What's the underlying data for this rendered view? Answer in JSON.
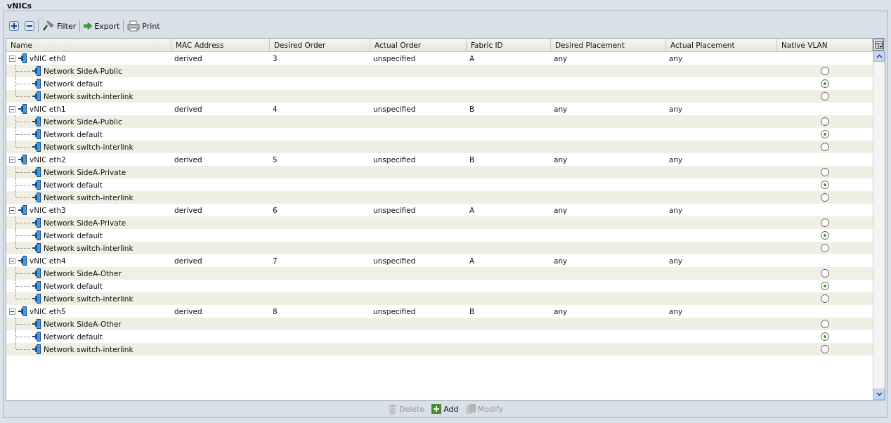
{
  "panel": {
    "title": "vNICs"
  },
  "toolbar": [
    {
      "kind": "expand"
    },
    {
      "kind": "collapse"
    },
    {
      "kind": "filter",
      "label": "Filter"
    },
    {
      "kind": "export",
      "label": "Export"
    },
    {
      "kind": "print",
      "label": "Print"
    }
  ],
  "table": {
    "columns": [
      "Name",
      "MAC Address",
      "Desired Order",
      "Actual Order",
      "Fabric ID",
      "Desired Placement",
      "Actual Placement",
      "Native VLAN"
    ],
    "rows": [
      {
        "name": "vNIC eth0",
        "mac": "derived",
        "desired_order": "3",
        "actual_order": "unspecified",
        "fabric_id": "A",
        "desired_placement": "any",
        "actual_placement": "any",
        "expanded": true,
        "children": [
          {
            "name": "Network SideA-Public",
            "selected": false
          },
          {
            "name": "Network default",
            "selected": true
          },
          {
            "name": "Network switch-interlink",
            "selected": false
          }
        ]
      },
      {
        "name": "vNIC eth1",
        "mac": "derived",
        "desired_order": "4",
        "actual_order": "unspecified",
        "fabric_id": "B",
        "desired_placement": "any",
        "actual_placement": "any",
        "expanded": true,
        "children": [
          {
            "name": "Network SideA-Public",
            "selected": false
          },
          {
            "name": "Network default",
            "selected": true
          },
          {
            "name": "Network switch-interlink",
            "selected": false
          }
        ]
      },
      {
        "name": "vNIC eth2",
        "mac": "derived",
        "desired_order": "5",
        "actual_order": "unspecified",
        "fabric_id": "B",
        "desired_placement": "any",
        "actual_placement": "any",
        "expanded": true,
        "children": [
          {
            "name": "Network SideA-Private",
            "selected": false
          },
          {
            "name": "Network default",
            "selected": true
          },
          {
            "name": "Network switch-interlink",
            "selected": false
          }
        ]
      },
      {
        "name": "vNIC eth3",
        "mac": "derived",
        "desired_order": "6",
        "actual_order": "unspecified",
        "fabric_id": "A",
        "desired_placement": "any",
        "actual_placement": "any",
        "expanded": true,
        "children": [
          {
            "name": "Network SideA-Private",
            "selected": false
          },
          {
            "name": "Network default",
            "selected": true
          },
          {
            "name": "Network switch-interlink",
            "selected": false
          }
        ]
      },
      {
        "name": "vNIC eth4",
        "mac": "derived",
        "desired_order": "7",
        "actual_order": "unspecified",
        "fabric_id": "A",
        "desired_placement": "any",
        "actual_placement": "any",
        "expanded": true,
        "children": [
          {
            "name": "Network SideA-Other",
            "selected": false
          },
          {
            "name": "Network default",
            "selected": true
          },
          {
            "name": "Network switch-interlink",
            "selected": false
          }
        ]
      },
      {
        "name": "vNIC eth5",
        "mac": "derived",
        "desired_order": "8",
        "actual_order": "unspecified",
        "fabric_id": "B",
        "desired_placement": "any",
        "actual_placement": "any",
        "expanded": true,
        "children": [
          {
            "name": "Network SideA-Other",
            "selected": false
          },
          {
            "name": "Network default",
            "selected": true
          },
          {
            "name": "Network switch-interlink",
            "selected": false
          }
        ]
      }
    ]
  },
  "actions": [
    {
      "kind": "delete",
      "label": "Delete",
      "disabled": true
    },
    {
      "kind": "add",
      "label": "Add",
      "disabled": false
    },
    {
      "kind": "modify",
      "label": "Modify",
      "disabled": true
    }
  ]
}
